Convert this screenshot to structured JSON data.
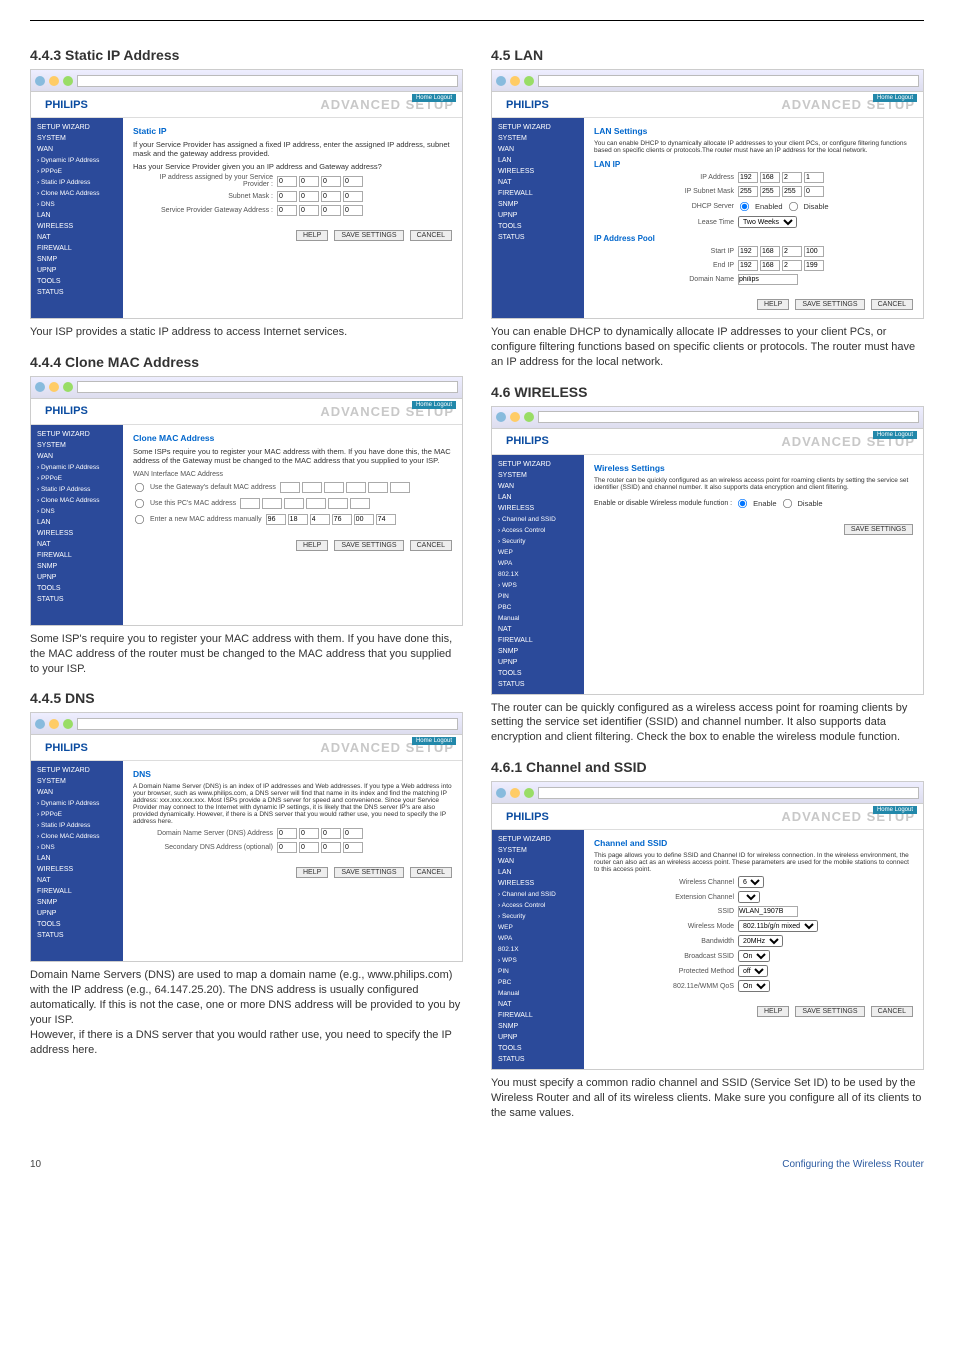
{
  "page_number": "10",
  "footer_right": "Configuring the Wireless Router",
  "brand": "PHILIPS",
  "adv_label": "ADVANCED SETUP",
  "home_logout": "Home  Logout",
  "buttons": {
    "help": "HELP",
    "save": "SAVE SETTINGS",
    "cancel": "CANCEL"
  },
  "sidebar_common": [
    "SETUP WIZARD",
    "SYSTEM",
    "WAN",
    "LAN",
    "WIRELESS",
    "NAT",
    "FIREWALL",
    "SNMP",
    "UPNP",
    "TOOLS",
    "STATUS"
  ],
  "s443": {
    "title": "4.4.3  Static IP Address",
    "panel": "Static IP",
    "text1": "If your Service Provider has assigned a fixed IP address, enter the assigned IP address, subnet mask and the gateway address provided.",
    "text2": "Has your Service Provider given you an IP address and Gateway address?",
    "row1": "IP address assigned by your Service Provider :",
    "row2": "Subnet Mask :",
    "row3": "Service Provider Gateway Address :",
    "ip": [
      "0",
      "0",
      "0",
      "0"
    ],
    "desc": "Your ISP provides a static IP address to access Internet services.",
    "sidebar_wan": [
      "› Dynamic IP Address",
      "› PPPoE",
      "› Static IP Address",
      "› Clone MAC Address",
      "› DNS"
    ]
  },
  "s444": {
    "title": "4.4.4  Clone MAC Address",
    "panel": "Clone MAC Address",
    "text1": "Some ISPs require you to register your MAC address with them. If you have done this, the MAC address of the Gateway must be changed to the MAC address that you supplied to your ISP.",
    "label_wan": "WAN Interface MAC Address",
    "opt1": "Use the Gateway's default MAC address",
    "opt2": "Use this PC's MAC address",
    "opt3": "Enter a new MAC address manually",
    "mac1": [
      "",
      "",
      "",
      "",
      "",
      ""
    ],
    "mac2": [
      "",
      "",
      "",
      "",
      "",
      ""
    ],
    "mac3": [
      "96",
      "18",
      "4",
      "76",
      "00",
      "74"
    ],
    "desc": "Some ISP's require you to register your MAC address with them. If you have done this, the MAC address of the router must be changed to the MAC address that you supplied to your ISP."
  },
  "s445": {
    "title": "4.4.5  DNS",
    "panel": "DNS",
    "text1": "A Domain Name Server (DNS) is an index of IP addresses and Web addresses. If you type a Web address into your browser, such as www.philips.com, a DNS server will find that name in its index and find the matching IP address: xxx.xxx.xxx.xxx. Most ISPs provide a DNS server for speed and convenience. Since your Service Provider may connect to the Internet with dynamic IP settings, it is likely that the DNS server IP's are also provided dynamically. However, if there is a DNS server that you would rather use, you need to specify the IP address here.",
    "row1": "Domain Name Server (DNS) Address",
    "row2": "Secondary DNS Address (optional)",
    "ip": [
      "0",
      "0",
      "0",
      "0"
    ],
    "desc": "Domain Name Servers (DNS) are used to map a domain name (e.g., www.philips.com) with the IP address (e.g., 64.147.25.20). The DNS address is usually configured automatically. If this is not the case, one or more DNS address will be provided to you by your ISP.\nHowever, if there is a DNS server that you would rather use, you need to specify the IP address here."
  },
  "s45": {
    "title": "4.5   LAN",
    "panel": "LAN Settings",
    "text1": "You can enable DHCP to dynamically allocate IP addresses to your client PCs, or configure filtering functions based on specific clients or protocols.The router must have an IP address for the local network.",
    "sub1": "LAN IP",
    "r_ip": "IP Address",
    "r_mask": "IP Subnet Mask",
    "r_dhcp": "DHCP Server",
    "dhcp_en": "Enabled",
    "dhcp_dis": "Disable",
    "r_lease": "Lease Time",
    "lease_val": "Two Weeks",
    "sub2": "IP Address Pool",
    "r_start": "Start IP",
    "r_end": "End IP",
    "r_dom": "Domain Name",
    "ip_addr": [
      "192",
      "168",
      "2",
      "1"
    ],
    "mask": [
      "255",
      "255",
      "255",
      "0"
    ],
    "start": [
      "192",
      "168",
      "2",
      "100"
    ],
    "end": [
      "192",
      "168",
      "2",
      "199"
    ],
    "domain": "philips",
    "desc": "You can enable DHCP to dynamically allocate IP addresses to your client PCs, or configure filtering functions based on specific clients or protocols. The router must have an IP address for the local network."
  },
  "s46": {
    "title": "4.6   WIRELESS",
    "panel": "Wireless Settings",
    "text1": "The router can be quickly configured as an wireless access point for roaming clients by setting the service set identifier (SSID) and channel number. It also supports data encryption and client filtering.",
    "r_enable": "Enable or disable Wireless module function :",
    "en": "Enable",
    "dis": "Disable",
    "save_btn": "SAVE SETTINGS",
    "desc": "The router can be quickly configured as a wireless access point for roaming clients by setting the service set identifier (SSID) and channel number. It also supports data encryption and client filtering. Check the box to enable the wireless module function.",
    "sidebar_wl": [
      "› Channel and SSID",
      "› Access Control",
      "› Security",
      "  WEP",
      "  WPA",
      "  802.1X",
      "› WPS",
      "  PIN",
      "  PBC",
      "  Manual"
    ]
  },
  "s461": {
    "title": "4.6.1  Channel and SSID",
    "panel": "Channel and SSID",
    "text1": "This page allows you to define SSID and Channel ID for wireless connection. In the wireless environment, the router can also act as an wireless access point. These parameters are used for the mobile stations to connect to this access point.",
    "r_wch": "Wireless Channel",
    "r_ech": "Extension Channel",
    "r_ssid": "SSID",
    "r_wmode": "Wireless Mode",
    "r_bw": "Bandwidth",
    "r_bssid": "Broadcast SSID",
    "r_pmeth": "Protected Method",
    "r_gi": "802.11e/WMM QoS",
    "wch_val": "6",
    "ech_val": "",
    "ssid_val": "WLAN_1907B",
    "wmode_val": "802.11b/g/n mixed",
    "bw_val": "20MHz",
    "bssid_val": "On",
    "pmeth_val": "off",
    "gi_val": "On",
    "desc": "You must specify a common radio channel and SSID (Service Set ID) to be used by the Wireless Router and all of its wireless clients. Make sure you configure all of its clients to the same values."
  }
}
